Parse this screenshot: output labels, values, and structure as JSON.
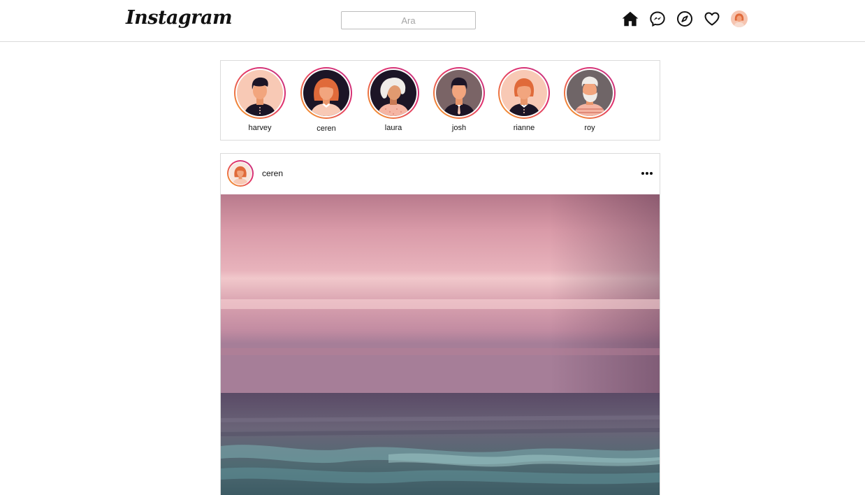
{
  "header": {
    "logo": "Instagram",
    "search": {
      "placeholder": "Ara",
      "value": ""
    },
    "nav": [
      "home-icon",
      "messenger-icon",
      "explore-icon",
      "heart-icon",
      "profile-avatar"
    ]
  },
  "stories": [
    {
      "name": "harvey"
    },
    {
      "name": "ceren"
    },
    {
      "name": "laura"
    },
    {
      "name": "josh"
    },
    {
      "name": "rianne"
    },
    {
      "name": "roy"
    }
  ],
  "post": {
    "username": "ceren",
    "more_icon": "more-icon"
  },
  "colors": {
    "story_ring_start": "#f5a623",
    "story_ring_end": "#c13584",
    "border": "#dbdbdb"
  }
}
